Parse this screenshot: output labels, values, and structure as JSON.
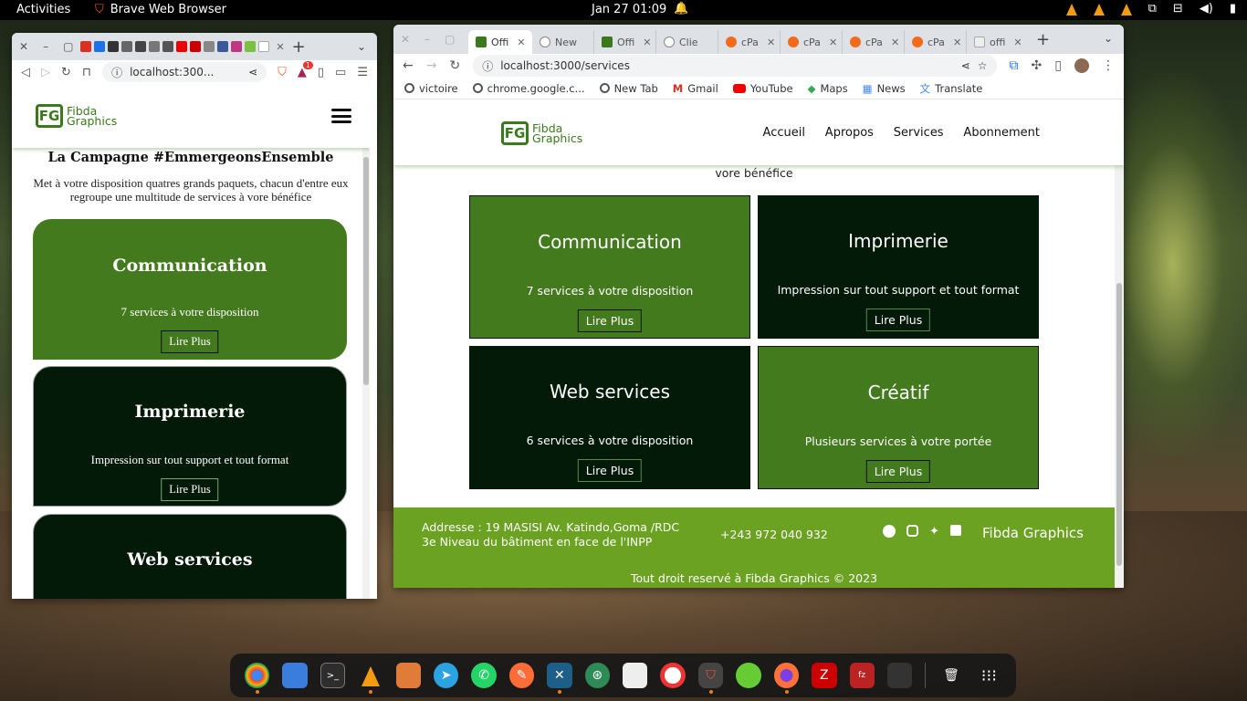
{
  "system": {
    "activities": "Activities",
    "app_name": "Brave Web Browser",
    "clock": "Jan 27  01:09"
  },
  "left_window": {
    "url": "localhost:300...",
    "notif_count": "1",
    "site": {
      "logo_line1": "Fibda",
      "logo_line2": "Graphics"
    },
    "heading": "La Campagne #EmmergeonsEnsemble",
    "intro": "Met à votre disposition quatres grands paquets, chacun d'entre eux regroupe une multitude de services à vore bénéfice",
    "cards": [
      {
        "title": "Communication",
        "desc": "7 services à votre disposition",
        "btn": "Lire Plus"
      },
      {
        "title": "Imprimerie",
        "desc": "Impression sur tout support et tout format",
        "btn": "Lire Plus"
      },
      {
        "title": "Web services"
      }
    ]
  },
  "right_window": {
    "tabs": [
      {
        "label": "Offi"
      },
      {
        "label": "New"
      },
      {
        "label": "Offi"
      },
      {
        "label": "Clie"
      },
      {
        "label": "cPa"
      },
      {
        "label": "cPa"
      },
      {
        "label": "cPa"
      },
      {
        "label": "cPa"
      },
      {
        "label": "offi"
      }
    ],
    "url": "localhost:3000/services",
    "bookmarks": [
      "victoire",
      "chrome.google.c...",
      "New Tab",
      "Gmail",
      "YouTube",
      "Maps",
      "News",
      "Translate"
    ],
    "site": {
      "logo_line1": "Fibda",
      "logo_line2": "Graphics",
      "nav": [
        "Accueil",
        "Apropos",
        "Services",
        "Abonnement"
      ]
    },
    "partial_text": "vore bénéfice",
    "cards": [
      {
        "title": "Communication",
        "desc": "7 services à votre disposition",
        "btn": "Lire Plus"
      },
      {
        "title": "Imprimerie",
        "desc": "Impression sur tout support et tout format",
        "btn": "Lire Plus"
      },
      {
        "title": "Web services",
        "desc": "6 services à votre disposition",
        "btn": "Lire Plus"
      },
      {
        "title": "Créatif",
        "desc": "Plusieurs services à votre portée",
        "btn": "Lire Plus"
      }
    ],
    "footer": {
      "address1": "Addresse : 19 MASISI Av. Katindo,Goma /RDC",
      "address2": "3e Niveau du bâtiment en face de l'INPP",
      "phone": "+243 972 040 932",
      "brand": "Fibda Graphics",
      "copyright": "Tout droit reservé à Fibda Graphics © 2023"
    }
  },
  "colors": {
    "brand_green": "#437a1e",
    "dark_green": "#041a08",
    "footer_green": "#6ba221"
  }
}
